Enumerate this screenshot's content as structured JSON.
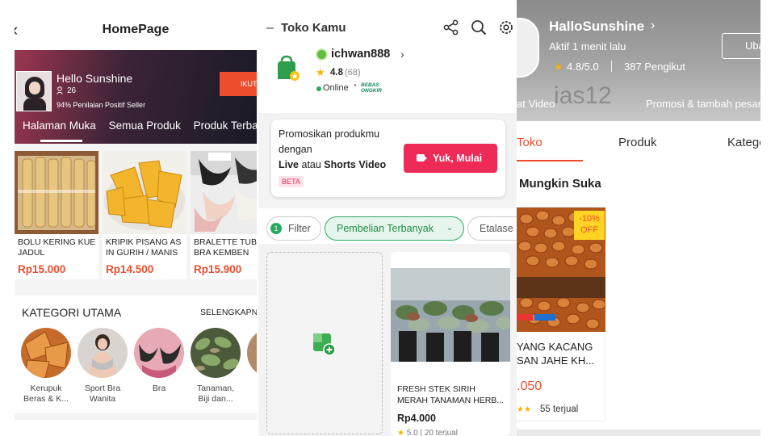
{
  "panel1": {
    "title": "HomePage",
    "shop_name": "Hello Sunshine",
    "followers": "26",
    "rating_text": "94% Penilaian Positif Seller",
    "follow_label": "IKUTI",
    "tabs": [
      "Halaman Muka",
      "Semua Produk",
      "Produk Terbaru"
    ],
    "products": [
      {
        "name_line1": "BOLU KERING KUE",
        "name_line2": "JADUL",
        "price": "Rp15.000"
      },
      {
        "name_line1": "KRIPIK PISANG AS",
        "name_line2": "IN GURIH / MANIS",
        "price": "Rp14.500"
      },
      {
        "name_line1": "BRALETTE TUBE",
        "name_line2": "BRA KEMBEN",
        "price": "Rp15.900"
      }
    ],
    "category_title": "KATEGORI UTAMA",
    "category_all": "SELENGKAPNYA",
    "categories": [
      {
        "line1": "Kerupuk",
        "line2": "Beras & K..."
      },
      {
        "line1": "Sport Bra",
        "line2": "Wanita"
      },
      {
        "line1": "Bra",
        "line2": ""
      },
      {
        "line1": "Tanaman,",
        "line2": "Biji dan..."
      },
      {
        "line1": "",
        "line2": ""
      }
    ]
  },
  "panel2": {
    "title": "Toko Kamu",
    "username": "ichwan888",
    "rating": "4.8",
    "rating_count": "(68)",
    "status": "Online",
    "ongkir_line1": "BEBAS",
    "ongkir_line2": "ONGKIR",
    "promo_line1": "Promosikan produkmu",
    "promo_line2": "dengan",
    "promo_bold1": "Live",
    "promo_mid": " atau ",
    "promo_bold2": "Shorts Video",
    "beta": "BETA",
    "cta": "Yuk, Mulai",
    "filter_count": "1",
    "filter_label": "Filter",
    "chip_active": "Pembelian Terbanyak",
    "chip_etalase": "Etalase",
    "product": {
      "name_line1": "FRESH STEK SIRIH",
      "name_line2": "MERAH TANAMAN HERB...",
      "price": "Rp4.000",
      "rating": "5.0",
      "sold": "20 terjual"
    }
  },
  "panel3": {
    "shop_name": "HalloSunshine",
    "active": "Aktif 1 menit lalu",
    "rating": "4.8/5.0",
    "followers": "387 Pengikut",
    "ubah": "Ubah",
    "video_label": "at Video",
    "promo_label": "Promosi & tambah pesanan",
    "watermark": "ias12",
    "tabs": [
      "Toko",
      "Produk",
      "Kategori"
    ],
    "section_title": "Mungkin Suka",
    "product": {
      "discount_line1": "-10%",
      "discount_line2": "OFF",
      "name_line1": "YANG KACANG",
      "name_line2": "SAN JAHE KH...",
      "price": ".050",
      "sold": "55 terjual"
    }
  },
  "colors": {
    "accent_orange": "#ee4d2d",
    "accent_pink": "#ee2a57",
    "accent_green": "#2daa60",
    "star": "#f5b400"
  }
}
